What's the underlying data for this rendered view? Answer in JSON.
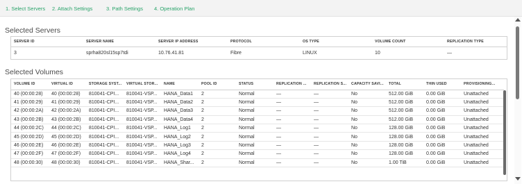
{
  "steps": [
    "1. Select Servers",
    "2. Attach Settings",
    "3. Path Settings",
    "4. Operation Plan"
  ],
  "selected_servers": {
    "title": "Selected Servers",
    "columns": [
      "SERVER ID",
      "SERVER NAME",
      "SERVER IP ADDRESS",
      "PROTOCOL",
      "OS TYPE",
      "VOLUME COUNT",
      "REPLICATION TYPE"
    ],
    "rows": [
      [
        "3",
        "sprha820sl15sp7tdi",
        "10.76.41.81",
        "Fibre",
        "LINUX",
        "10",
        "—"
      ]
    ]
  },
  "selected_volumes": {
    "title": "Selected Volumes",
    "columns": [
      "VOLUME ID",
      "VIRTUAL ID",
      "STORAGE SYST...",
      "VIRTUAL STOR...",
      "NAME",
      "POOL ID",
      "STATUS",
      "REPLICATION ...",
      "REPLICATION S...",
      "CAPACITY SAVI...",
      "TOTAL",
      "THIN USED",
      "PROVISIONING..."
    ],
    "rows": [
      [
        "40 (00:00:28)",
        "40 (00:00:28)",
        "810041-CPI...",
        "810041-VSP...",
        "HANA_Data1",
        "2",
        "Normal",
        "—",
        "—",
        "No",
        "512.00 GiB",
        "0.00 GiB",
        "Unattached"
      ],
      [
        "41 (00:00:29)",
        "41 (00:00:29)",
        "810041-CPI...",
        "810041-VSP...",
        "HANA_Data2",
        "2",
        "Normal",
        "—",
        "—",
        "No",
        "512.00 GiB",
        "0.00 GiB",
        "Unattached"
      ],
      [
        "42 (00:00:2A)",
        "42 (00:00:2A)",
        "810041-CPI...",
        "810041-VSP...",
        "HANA_Data3",
        "2",
        "Normal",
        "—",
        "—",
        "No",
        "512.00 GiB",
        "0.00 GiB",
        "Unattached"
      ],
      [
        "43 (00:00:2B)",
        "43 (00:00:2B)",
        "810041-CPI...",
        "810041-VSP...",
        "HANA_Data4",
        "2",
        "Normal",
        "—",
        "—",
        "No",
        "512.00 GiB",
        "0.00 GiB",
        "Unattached"
      ],
      [
        "44 (00:00:2C)",
        "44 (00:00:2C)",
        "810041-CPI...",
        "810041-VSP...",
        "HANA_Log1",
        "2",
        "Normal",
        "—",
        "—",
        "No",
        "128.00 GiB",
        "0.00 GiB",
        "Unattached"
      ],
      [
        "45 (00:00:2D)",
        "45 (00:00:2D)",
        "810041-CPI...",
        "810041-VSP...",
        "HANA_Log2",
        "2",
        "Normal",
        "—",
        "—",
        "No",
        "128.00 GiB",
        "0.00 GiB",
        "Unattached"
      ],
      [
        "46 (00:00:2E)",
        "46 (00:00:2E)",
        "810041-CPI...",
        "810041-VSP...",
        "HANA_Log3",
        "2",
        "Normal",
        "—",
        "—",
        "No",
        "128.00 GiB",
        "0.00 GiB",
        "Unattached"
      ],
      [
        "47 (00:00:2F)",
        "47 (00:00:2F)",
        "810041-CPI...",
        "810041-VSP...",
        "HANA_Log4",
        "2",
        "Normal",
        "—",
        "—",
        "No",
        "128.00 GiB",
        "0.00 GiB",
        "Unattached"
      ],
      [
        "48 (00:00:30)",
        "48 (00:00:30)",
        "810041-CPI...",
        "810041-VSP...",
        "HANA_Shar...",
        "2",
        "Normal",
        "—",
        "—",
        "No",
        "1.00 TiB",
        "0.00 GiB",
        "Unattached"
      ]
    ]
  }
}
